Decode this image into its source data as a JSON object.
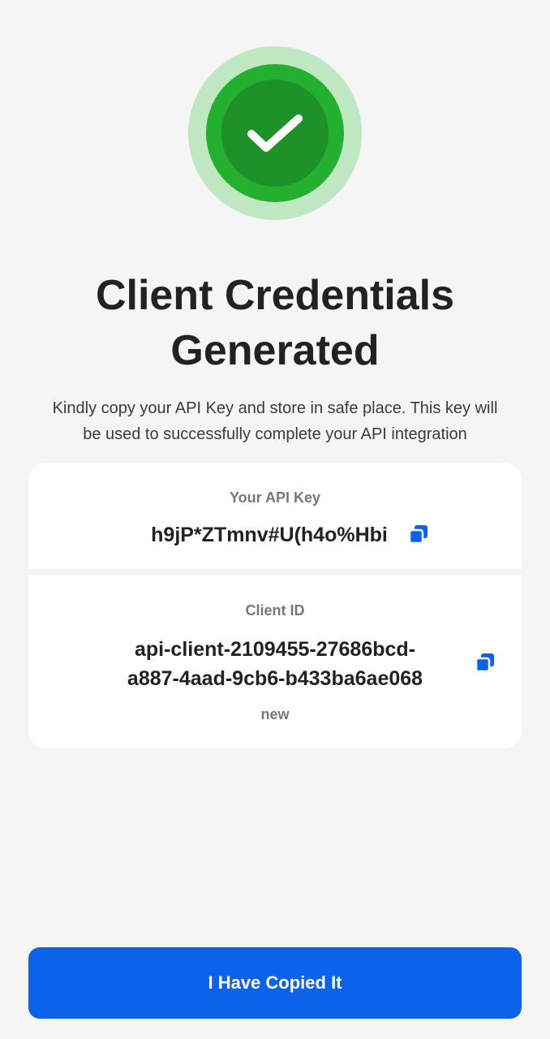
{
  "header": {
    "title_line1": "Client Credentials",
    "title_line2": "Generated",
    "subtitle_line1": "Kindly copy your API Key and store in safe place. This key will",
    "subtitle_line2": "be used to successfully complete your API integration"
  },
  "credentials": {
    "api_key": {
      "label": "Your API Key",
      "value": "h9jP*ZTmnv#U(h4o%Hbi",
      "copy_icon": "copy-icon"
    },
    "client_id": {
      "label": "Client ID",
      "value_line1": "api-client-2109455-27686bcd-",
      "value_line2": "a887-4aad-9cb6-b433ba6ae068",
      "status": "new",
      "copy_icon": "copy-icon"
    }
  },
  "footer": {
    "confirm_label": "I Have Copied It"
  },
  "colors": {
    "accent": "#0a63ea",
    "success_outer": "#bfe8c2",
    "success_mid": "#22b02e",
    "success_inner": "#1e9128",
    "background": "#f5f5f5"
  }
}
